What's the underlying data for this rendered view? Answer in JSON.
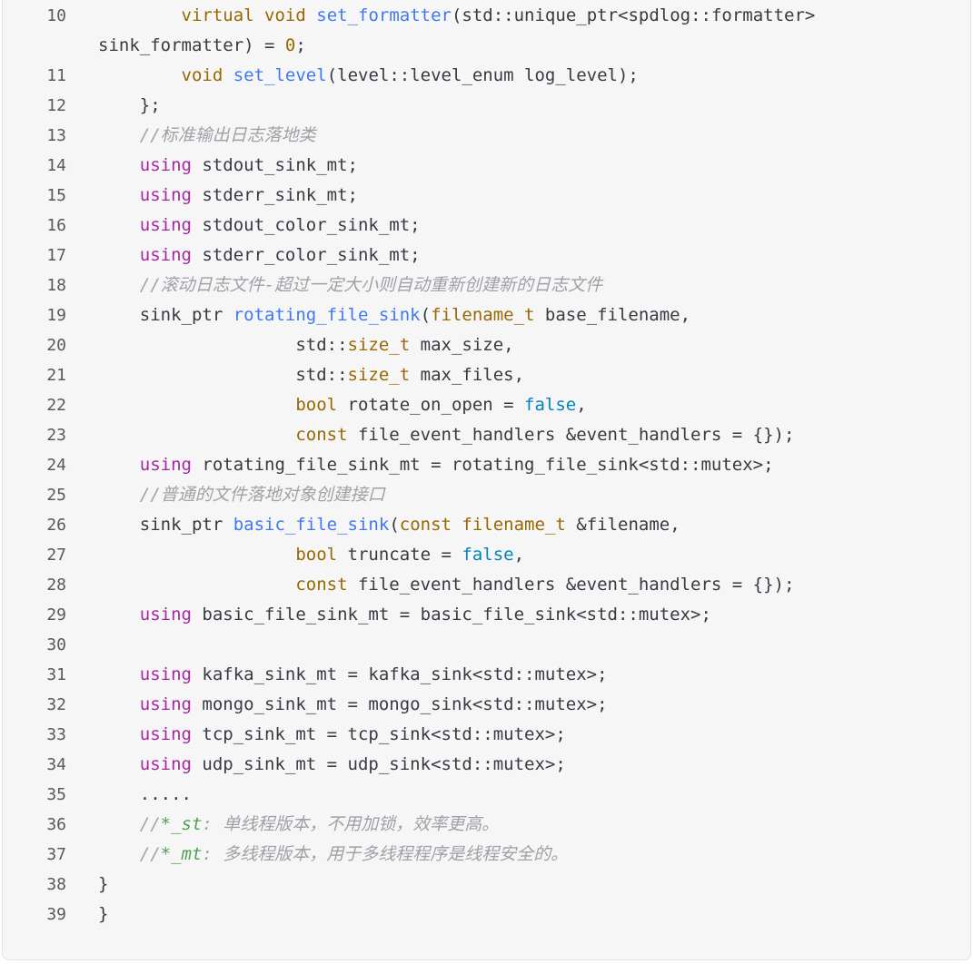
{
  "code": {
    "language": "cpp",
    "lines": [
      {
        "n": "10",
        "wrap": true,
        "tokens": [
          {
            "t": "        "
          },
          {
            "t": "virtual",
            "c": "t"
          },
          {
            "t": " "
          },
          {
            "t": "void",
            "c": "t"
          },
          {
            "t": " "
          },
          {
            "t": "set_formatter",
            "c": "f"
          },
          {
            "t": "(std::unique_ptr<spdlog::formatter> sink_formatter) = "
          },
          {
            "t": "0",
            "c": "n"
          },
          {
            "t": ";"
          }
        ]
      },
      {
        "n": "11",
        "tokens": [
          {
            "t": "        "
          },
          {
            "t": "void",
            "c": "t"
          },
          {
            "t": " "
          },
          {
            "t": "set_level",
            "c": "f"
          },
          {
            "t": "(level::level_enum log_level);"
          }
        ]
      },
      {
        "n": "12",
        "tokens": [
          {
            "t": "    };"
          }
        ]
      },
      {
        "n": "13",
        "tokens": [
          {
            "t": "    "
          },
          {
            "t": "//标准输出日志落地类",
            "c": "c"
          }
        ]
      },
      {
        "n": "14",
        "tokens": [
          {
            "t": "    "
          },
          {
            "t": "using",
            "c": "k"
          },
          {
            "t": " stdout_sink_mt;"
          }
        ]
      },
      {
        "n": "15",
        "tokens": [
          {
            "t": "    "
          },
          {
            "t": "using",
            "c": "k"
          },
          {
            "t": " stderr_sink_mt;"
          }
        ]
      },
      {
        "n": "16",
        "tokens": [
          {
            "t": "    "
          },
          {
            "t": "using",
            "c": "k"
          },
          {
            "t": " stdout_color_sink_mt;"
          }
        ]
      },
      {
        "n": "17",
        "tokens": [
          {
            "t": "    "
          },
          {
            "t": "using",
            "c": "k"
          },
          {
            "t": " stderr_color_sink_mt;"
          }
        ]
      },
      {
        "n": "18",
        "tokens": [
          {
            "t": "    "
          },
          {
            "t": "//滚动日志文件-超过一定大小则自动重新创建新的日志文件",
            "c": "c"
          }
        ]
      },
      {
        "n": "19",
        "tokens": [
          {
            "t": "    sink_ptr "
          },
          {
            "t": "rotating_file_sink",
            "c": "f"
          },
          {
            "t": "("
          },
          {
            "t": "filename_t",
            "c": "t"
          },
          {
            "t": " base_filename,"
          }
        ]
      },
      {
        "n": "20",
        "tokens": [
          {
            "t": "                   std::"
          },
          {
            "t": "size_t",
            "c": "t"
          },
          {
            "t": " max_size,"
          }
        ]
      },
      {
        "n": "21",
        "tokens": [
          {
            "t": "                   std::"
          },
          {
            "t": "size_t",
            "c": "t"
          },
          {
            "t": " max_files,"
          }
        ]
      },
      {
        "n": "22",
        "tokens": [
          {
            "t": "                   "
          },
          {
            "t": "bool",
            "c": "t"
          },
          {
            "t": " rotate_on_open = "
          },
          {
            "t": "false",
            "c": "b"
          },
          {
            "t": ","
          }
        ]
      },
      {
        "n": "23",
        "tokens": [
          {
            "t": "                   "
          },
          {
            "t": "const",
            "c": "t"
          },
          {
            "t": " file_event_handlers &event_handlers = {});"
          }
        ]
      },
      {
        "n": "24",
        "tokens": [
          {
            "t": "    "
          },
          {
            "t": "using",
            "c": "k"
          },
          {
            "t": " rotating_file_sink_mt = rotating_file_sink<std::mutex>;"
          }
        ]
      },
      {
        "n": "25",
        "tokens": [
          {
            "t": "    "
          },
          {
            "t": "//普通的文件落地对象创建接口",
            "c": "c"
          }
        ]
      },
      {
        "n": "26",
        "tokens": [
          {
            "t": "    sink_ptr "
          },
          {
            "t": "basic_file_sink",
            "c": "f"
          },
          {
            "t": "("
          },
          {
            "t": "const",
            "c": "t"
          },
          {
            "t": " "
          },
          {
            "t": "filename_t",
            "c": "t"
          },
          {
            "t": " &filename,"
          }
        ]
      },
      {
        "n": "27",
        "tokens": [
          {
            "t": "                   "
          },
          {
            "t": "bool",
            "c": "t"
          },
          {
            "t": " truncate = "
          },
          {
            "t": "false",
            "c": "b"
          },
          {
            "t": ","
          }
        ]
      },
      {
        "n": "28",
        "tokens": [
          {
            "t": "                   "
          },
          {
            "t": "const",
            "c": "t"
          },
          {
            "t": " file_event_handlers &event_handlers = {});"
          }
        ]
      },
      {
        "n": "29",
        "tokens": [
          {
            "t": "    "
          },
          {
            "t": "using",
            "c": "k"
          },
          {
            "t": " basic_file_sink_mt = basic_file_sink<std::mutex>;"
          }
        ]
      },
      {
        "n": "30",
        "tokens": [
          {
            "t": ""
          }
        ]
      },
      {
        "n": "31",
        "tokens": [
          {
            "t": "    "
          },
          {
            "t": "using",
            "c": "k"
          },
          {
            "t": " kafka_sink_mt = kafka_sink<std::mutex>;"
          }
        ]
      },
      {
        "n": "32",
        "tokens": [
          {
            "t": "    "
          },
          {
            "t": "using",
            "c": "k"
          },
          {
            "t": " mongo_sink_mt = mongo_sink<std::mutex>;"
          }
        ]
      },
      {
        "n": "33",
        "tokens": [
          {
            "t": "    "
          },
          {
            "t": "using",
            "c": "k"
          },
          {
            "t": " tcp_sink_mt = tcp_sink<std::mutex>;"
          }
        ]
      },
      {
        "n": "34",
        "tokens": [
          {
            "t": "    "
          },
          {
            "t": "using",
            "c": "k"
          },
          {
            "t": " udp_sink_mt = udp_sink<std::mutex>;"
          }
        ]
      },
      {
        "n": "35",
        "tokens": [
          {
            "t": "    ....."
          }
        ]
      },
      {
        "n": "36",
        "tokens": [
          {
            "t": "    "
          },
          {
            "t": "//",
            "c": "c"
          },
          {
            "t": "*_st",
            "c": "cg"
          },
          {
            "t": ": 单线程版本，不用加锁，效率更高。",
            "c": "c"
          }
        ]
      },
      {
        "n": "37",
        "tokens": [
          {
            "t": "    "
          },
          {
            "t": "//",
            "c": "c"
          },
          {
            "t": "*_mt",
            "c": "cg"
          },
          {
            "t": ": 多线程版本，用于多线程程序是线程安全的。",
            "c": "c"
          }
        ]
      },
      {
        "n": "38",
        "tokens": [
          {
            "t": "}"
          }
        ]
      },
      {
        "n": "39",
        "tokens": [
          {
            "t": "}"
          }
        ]
      }
    ]
  },
  "colors": {
    "background": "#f6f6f7",
    "keyword": "#a626a4",
    "type": "#986801",
    "function": "#4078f2",
    "boolean": "#0184bc",
    "comment": "#a0a1a7",
    "line_number": "#595959"
  }
}
